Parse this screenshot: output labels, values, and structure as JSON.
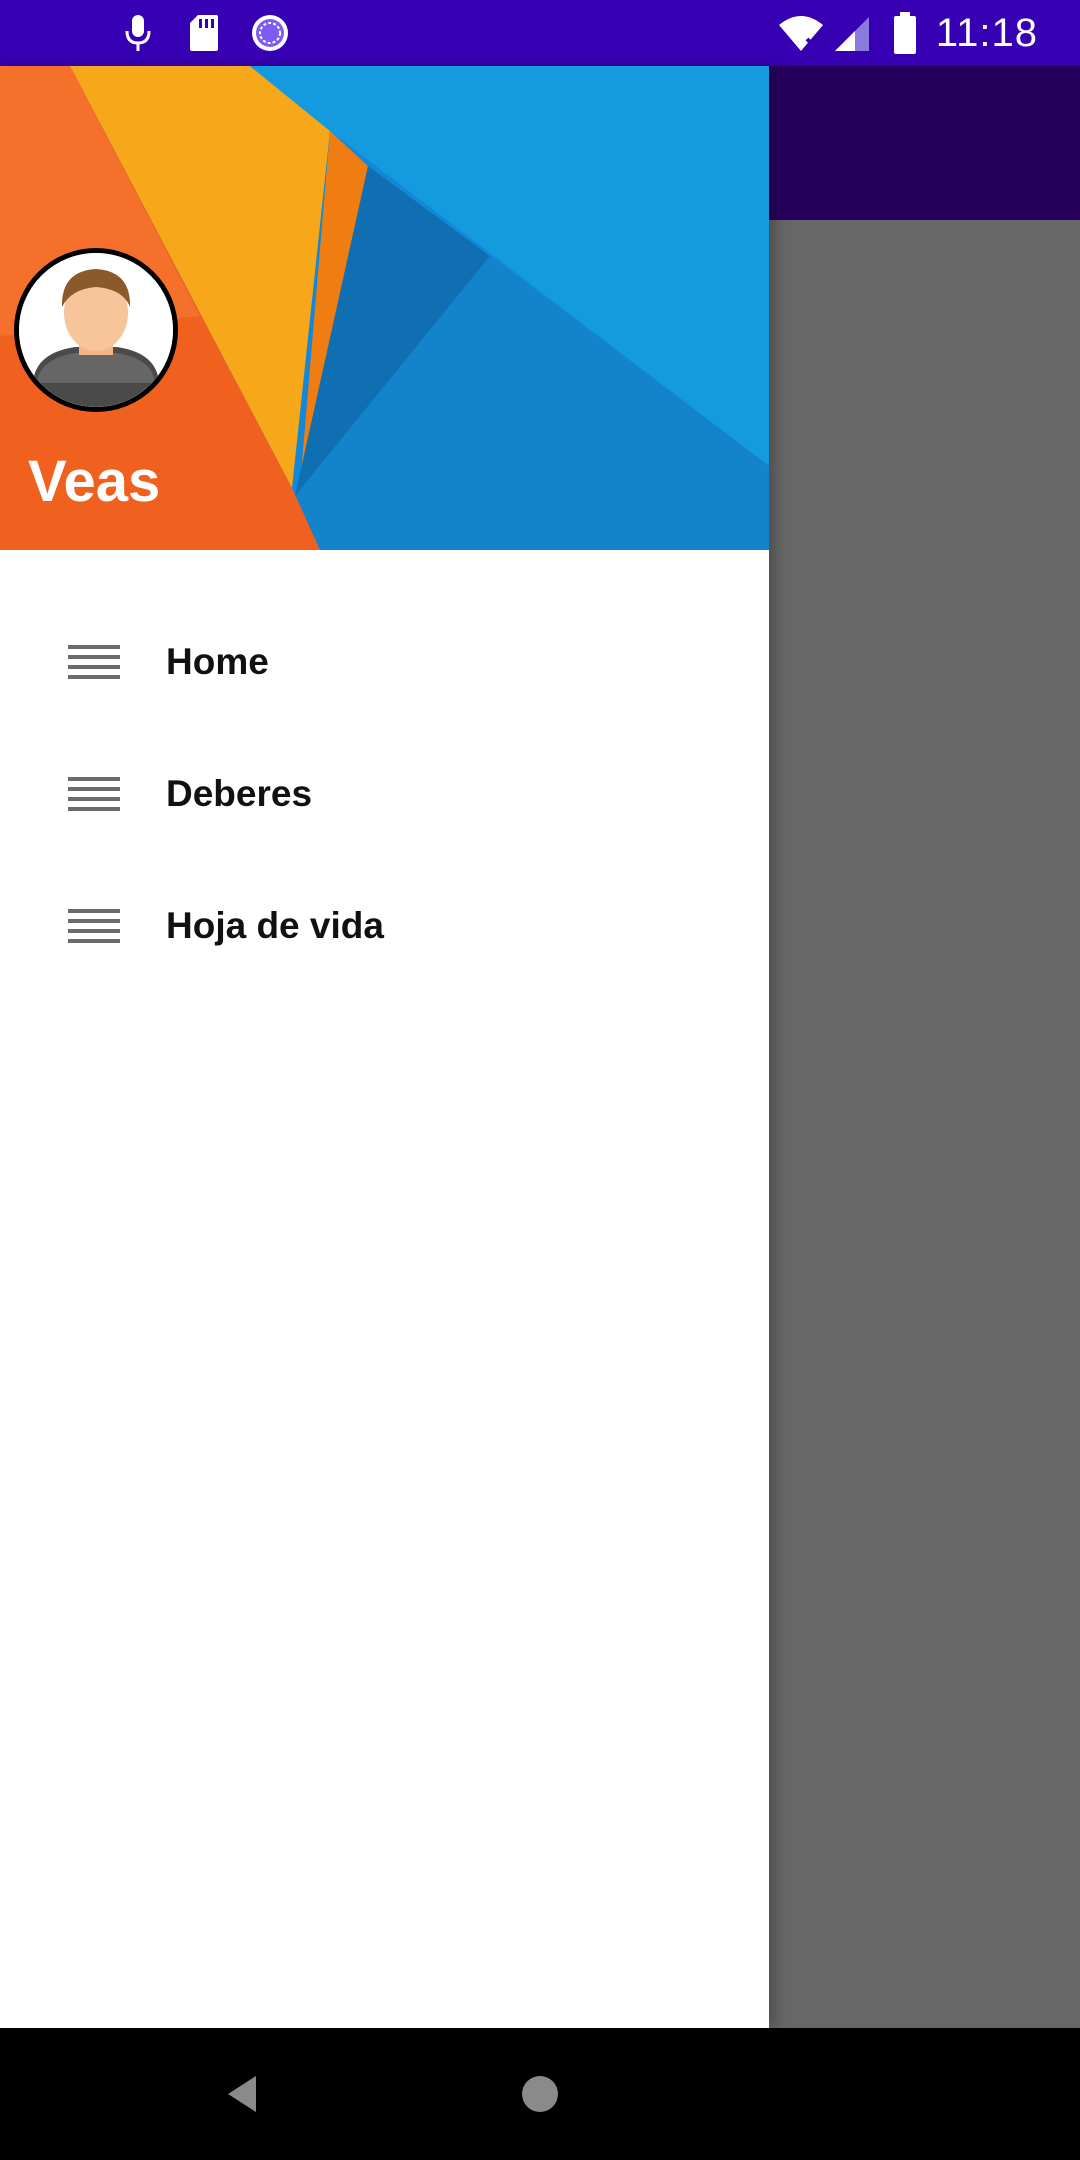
{
  "status_bar": {
    "time": "11:18",
    "background": "#3700b3",
    "icons": [
      "microphone-icon",
      "sd-card-icon",
      "loading-icon",
      "wifi-icon",
      "signal-icon",
      "battery-icon"
    ]
  },
  "app_bar": {
    "background": "#27005e"
  },
  "drawer": {
    "header": {
      "user_name": "Veas",
      "avatar": "avatar-icon"
    },
    "items": [
      {
        "label": "Home",
        "icon": "menu-icon"
      },
      {
        "label": "Deberes",
        "icon": "menu-icon"
      },
      {
        "label": "Hoja de vida",
        "icon": "menu-icon"
      }
    ]
  },
  "nav_bar": {
    "buttons": [
      "back-icon",
      "home-icon"
    ]
  }
}
